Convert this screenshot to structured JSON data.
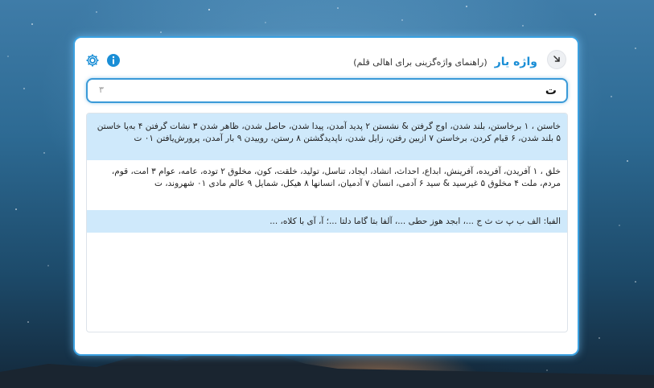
{
  "app": {
    "name": "واژه یار",
    "subtitle": "(راهنمای واژه‌گزینی برای اهالی قلم)"
  },
  "search": {
    "value": "ت",
    "count": "۳"
  },
  "results": [
    "خاستن ، ۱ برخاستن، بلند شدن، اوج گرفتن & نشستن ۲ پدید آمدن، پیدا شدن، حاصل شدن، ظاهر شدن ۳ نشات گرفتن ۴ به‌پا خاستن ۵ بلند شدن، ۶ قیام کردن، برخاستن ۷ ازبین رفتن، زایل شدن، ناپدیدگشتن ۸ رستن، روییدن ۹ بار آمدن، پرورش‌یافتن ۰۱ ت",
    "خلق ، ۱ آفریدن، آفریده، آفرینش، ابداع، احداث، انشاد، ایجاد، تناسل، تولید، خلقت، کون، مخلوق ۲ توده، عامه، عوام ۳ امت، قوم، مردم، ملت ۴ مخلوق ۵ غیرسید & سید ۶ آدمی، انسان ۷ آدمیان، انسانها ۸ هیکل، شمایل ۹ عالم مادی ۰۱ شهروند، ت",
    "الفبا: الف ب پ ت ث ج ...، ابجد هوز حطی ...، آلفا بتا گاما دلتا ...؛ آ، آی با کلاه، ..."
  ],
  "colors": {
    "accent": "#1a8ed6",
    "highlight": "#cfe9fb",
    "border": "#3aa0e0"
  },
  "icons": {
    "close": "collapse-arrow-icon",
    "settings": "gear-icon",
    "info": "info-icon"
  }
}
